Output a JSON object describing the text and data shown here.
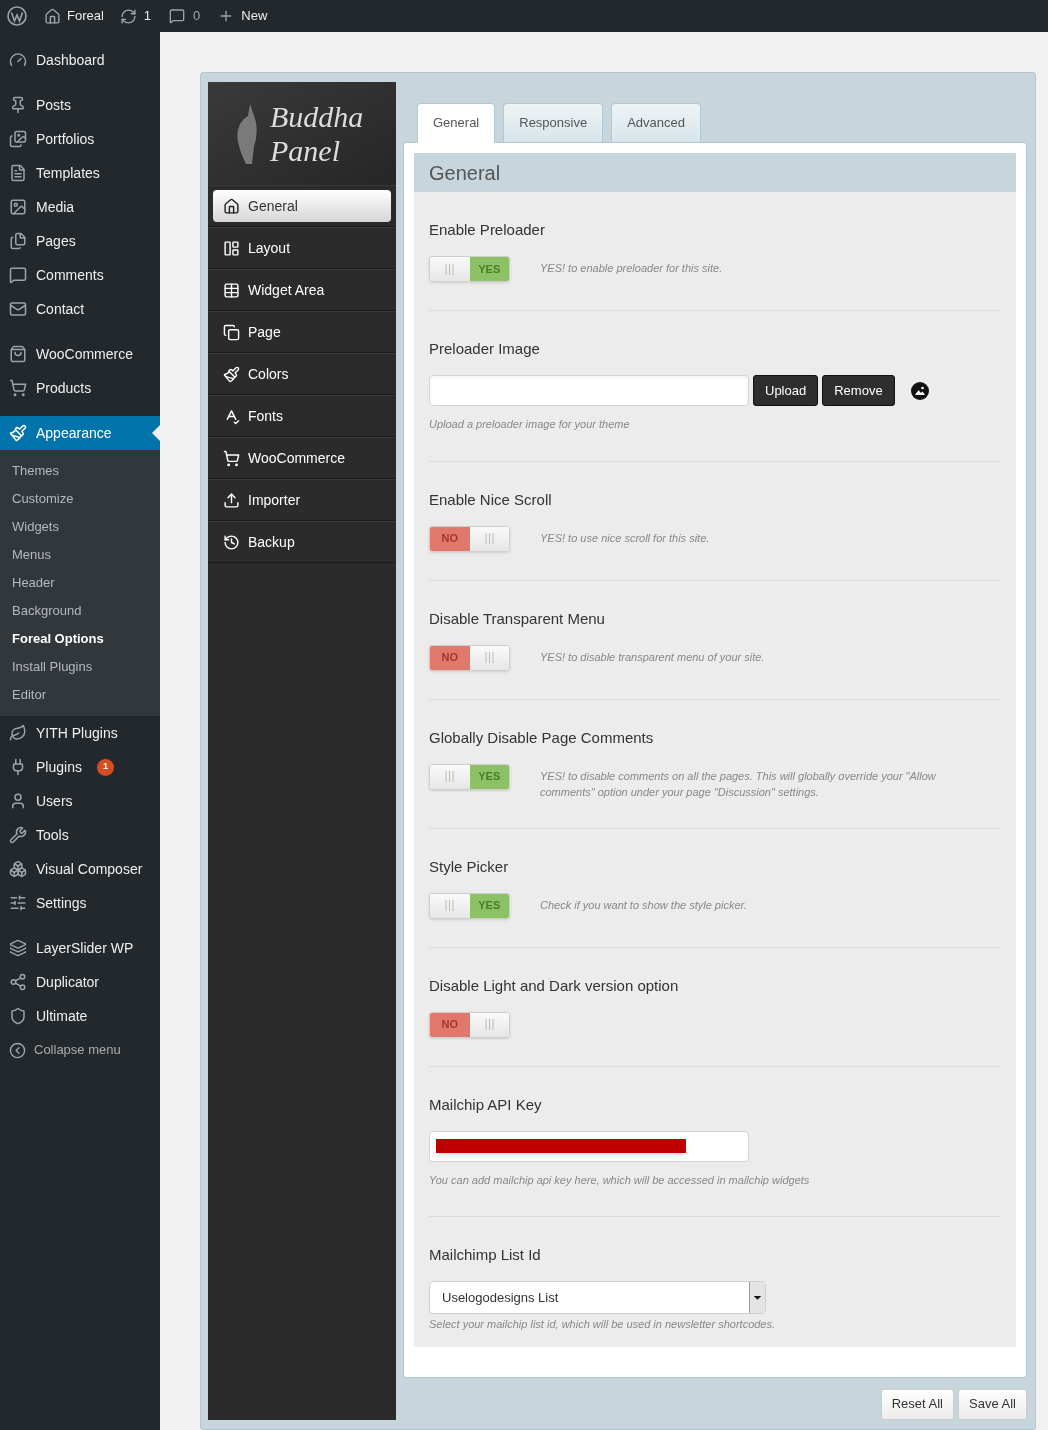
{
  "admin_bar": {
    "site_name": "Foreal",
    "updates_count": "1",
    "comments_count": "0",
    "new_label": "New"
  },
  "sidebar": {
    "groups": [
      {
        "items": [
          {
            "label": "Dashboard",
            "selected": false
          }
        ]
      },
      {
        "items": [
          {
            "label": "Posts",
            "selected": false
          },
          {
            "label": "Portfolios",
            "selected": false
          },
          {
            "label": "Templates",
            "selected": false
          },
          {
            "label": "Media",
            "selected": false
          },
          {
            "label": "Pages",
            "selected": false
          },
          {
            "label": "Comments",
            "selected": false
          },
          {
            "label": "Contact",
            "selected": false
          }
        ]
      },
      {
        "items": [
          {
            "label": "WooCommerce",
            "selected": false
          },
          {
            "label": "Products",
            "selected": false
          }
        ]
      },
      {
        "items": [
          {
            "label": "Appearance",
            "selected": true,
            "children": [
              {
                "label": "Themes",
                "selected": false
              },
              {
                "label": "Customize",
                "selected": false
              },
              {
                "label": "Widgets",
                "selected": false
              },
              {
                "label": "Menus",
                "selected": false
              },
              {
                "label": "Header",
                "selected": false
              },
              {
                "label": "Background",
                "selected": false
              },
              {
                "label": "Foreal Options",
                "selected": true
              },
              {
                "label": "Install Plugins",
                "selected": false
              },
              {
                "label": "Editor",
                "selected": false
              }
            ]
          },
          {
            "label": "YITH Plugins",
            "selected": false
          },
          {
            "label": "Plugins",
            "selected": false,
            "badge": "1"
          },
          {
            "label": "Users",
            "selected": false
          },
          {
            "label": "Tools",
            "selected": false
          },
          {
            "label": "Visual Composer",
            "selected": false
          },
          {
            "label": "Settings",
            "selected": false
          }
        ]
      },
      {
        "items": [
          {
            "label": "LayerSlider WP",
            "selected": false
          },
          {
            "label": "Duplicator",
            "selected": false
          },
          {
            "label": "Ultimate",
            "selected": false
          }
        ]
      }
    ],
    "collapse_label": "Collapse menu"
  },
  "panel": {
    "logo": {
      "line_1": "Buddha",
      "line_2": "Panel"
    },
    "nav": [
      {
        "label": "General",
        "selected": true
      },
      {
        "label": "Layout",
        "selected": false
      },
      {
        "label": "Widget Area",
        "selected": false
      },
      {
        "label": "Page",
        "selected": false
      },
      {
        "label": "Colors",
        "selected": false
      },
      {
        "label": "Fonts",
        "selected": false
      },
      {
        "label": "WooCommerce",
        "selected": false
      },
      {
        "label": "Importer",
        "selected": false
      },
      {
        "label": "Backup",
        "selected": false
      }
    ],
    "tabs": [
      {
        "label": "General",
        "selected": true
      },
      {
        "label": "Responsive",
        "selected": false
      },
      {
        "label": "Advanced",
        "selected": false
      }
    ],
    "section_title": "General",
    "options": [
      {
        "kind": "toggle",
        "label": "Enable Preloader",
        "on": true,
        "state_label": "YES",
        "description": "YES! to enable preloader for this site."
      },
      {
        "kind": "upload",
        "label": "Preloader Image",
        "upload_button": "Upload",
        "remove_button": "Remove",
        "help": "Upload a preloader image for your theme"
      },
      {
        "kind": "toggle",
        "label": "Enable Nice Scroll",
        "on": false,
        "state_label": "NO",
        "description": "YES! to use nice scroll for this site."
      },
      {
        "kind": "toggle",
        "label": "Disable Transparent Menu",
        "on": false,
        "state_label": "NO",
        "description": "YES! to disable transparent menu of your site."
      },
      {
        "kind": "toggle",
        "label": "Globally Disable Page Comments",
        "on": true,
        "state_label": "YES",
        "description": "YES! to disable comments on all the pages. This will globally override your \"Allow comments\" option under your page \"Discussion\" settings."
      },
      {
        "kind": "toggle",
        "label": "Style Picker",
        "on": true,
        "state_label": "YES",
        "description": "Check if you want to show the style picker."
      },
      {
        "kind": "toggle",
        "label": "Disable Light and Dark version option",
        "on": false,
        "state_label": "NO"
      },
      {
        "kind": "masked_text",
        "label": "Mailchip API Key",
        "help": "You can add mailchip api key here, which will be accessed in mailchip widgets"
      },
      {
        "kind": "select",
        "label": "Mailchimp List Id",
        "value": "Uselogodesigns List",
        "help": "Select your mailchip list id, which will be used in newsletter shortcodes."
      }
    ],
    "buttons": [
      "Reset All",
      "Save All"
    ]
  }
}
